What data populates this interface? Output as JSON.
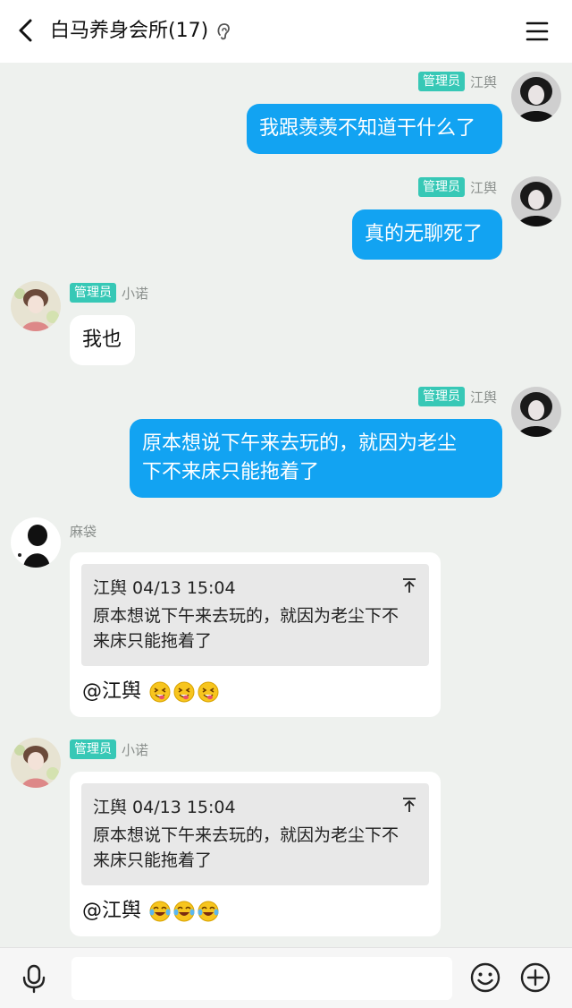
{
  "header": {
    "title": "白马养身会所(17)"
  },
  "messages": [
    {
      "sender": "江舆",
      "role": "管理员",
      "text": "我跟羡羡不知道干什么了"
    },
    {
      "sender": "江舆",
      "role": "管理员",
      "text": "真的无聊死了"
    },
    {
      "sender": "小诺",
      "role": "管理员",
      "text": "我也"
    },
    {
      "sender": "江舆",
      "role": "管理员",
      "text_line1": "原本想说下午来去玩的，就因为老尘",
      "text_line2": "下不来床只能拖着了"
    },
    {
      "sender": "麻袋",
      "quote_header": "江舆 04/13 15:04",
      "quote_line1": "原本想说下午来去玩的，就因为老尘下不",
      "quote_line2": "来床只能拖着了",
      "mention": "@江舆",
      "emoji_icon": "tongue-wink-emoji"
    },
    {
      "sender": "小诺",
      "role": "管理员",
      "quote_header": "江舆 04/13 15:04",
      "quote_line1": "原本想说下午来去玩的，就因为老尘下不",
      "quote_line2": "来床只能拖着了",
      "mention": "@江舆",
      "emoji_icon": "tears-of-joy-emoji"
    }
  ],
  "input": {
    "placeholder": ""
  },
  "colors": {
    "outgoing_bubble": "#12a3f2",
    "admin_badge": "#37c8b6",
    "chat_background": "#eef1ee"
  }
}
